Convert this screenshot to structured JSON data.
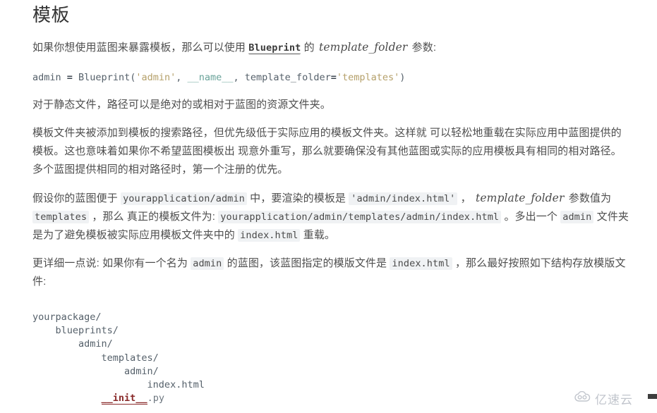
{
  "document": {
    "title": "模板",
    "paragraph_1": {
      "part_1": "如果你想使用蓝图来暴露模板，那么可以使用 ",
      "code_1": "Blueprint",
      "part_2": " 的 ",
      "italic_1": "template_folder",
      "part_3": " 参数:"
    },
    "code_block_1": {
      "plain_1": "admin ",
      "op_1": "=",
      "plain_2": " Blueprint(",
      "str_1": "'admin'",
      "plain_3": ", ",
      "dunder_1": "__name__",
      "plain_4": ", template_folder",
      "op_2": "=",
      "str_2": "'templates'",
      "plain_5": ")"
    },
    "paragraph_2": "对于静态文件，路径可以是绝对的或相对于蓝图的资源文件夹。",
    "paragraph_3": "模板文件夹被添加到模板的搜索路径，但优先级低于实际应用的模板文件夹。这样就 可以轻松地重载在实际应用中蓝图提供的模板。这也意味着如果你不希望蓝图模板出 现意外重写，那么就要确保没有其他蓝图或实际的应用模板具有相同的相对路径。 多个蓝图提供相同的相对路径时，第一个注册的优先。",
    "paragraph_4": {
      "part_1": "假设你的蓝图便于 ",
      "code_1": "yourapplication/admin",
      "part_2": " 中，要渲染的模板是 ",
      "code_2": "'admin/index.html'",
      "part_3": " ， ",
      "italic_1": "template_folder",
      "part_4": " 参数值为 ",
      "code_3": "templates",
      "part_5": " ，那么 真正的模板文件为: ",
      "code_4": "yourapplication/admin/templates/admin/index.html",
      "part_6": " 。多出一个 ",
      "code_5": "admin",
      "part_7": " 文件夹是为了避免模板被实际应用模板文件夹中的 ",
      "code_6": "index.html",
      "part_8": " 重载。"
    },
    "paragraph_5": {
      "part_1": "更详细一点说: 如果你有一个名为 ",
      "code_1": "admin",
      "part_2": " 的蓝图，该蓝图指定的模版文件是 ",
      "code_2": "index.html",
      "part_3": " ，那么最好按照如下结构存放模版文件:"
    },
    "code_block_2": {
      "line_1": "yourpackage/",
      "line_2": "    blueprints/",
      "line_3": "        admin/",
      "line_4": "            templates/",
      "line_5": "                admin/",
      "line_6": "                    index.html",
      "line_7_indent": "            ",
      "line_7_init": "__init__",
      "line_7_ext": ".py"
    }
  },
  "watermark": {
    "icon": "cloud-icon",
    "text": "亿速云"
  },
  "colors": {
    "page_background": "#ffffff",
    "body_text": "#4f4f4f",
    "heading_text": "#333333",
    "inline_code_background": "#f0f2f4",
    "code_block_text": "#55606a",
    "string_literal": "#b5a06a",
    "dunder": "#6aa39a",
    "init_accent": "#8a2b2b",
    "watermark": "#8f96a3"
  }
}
